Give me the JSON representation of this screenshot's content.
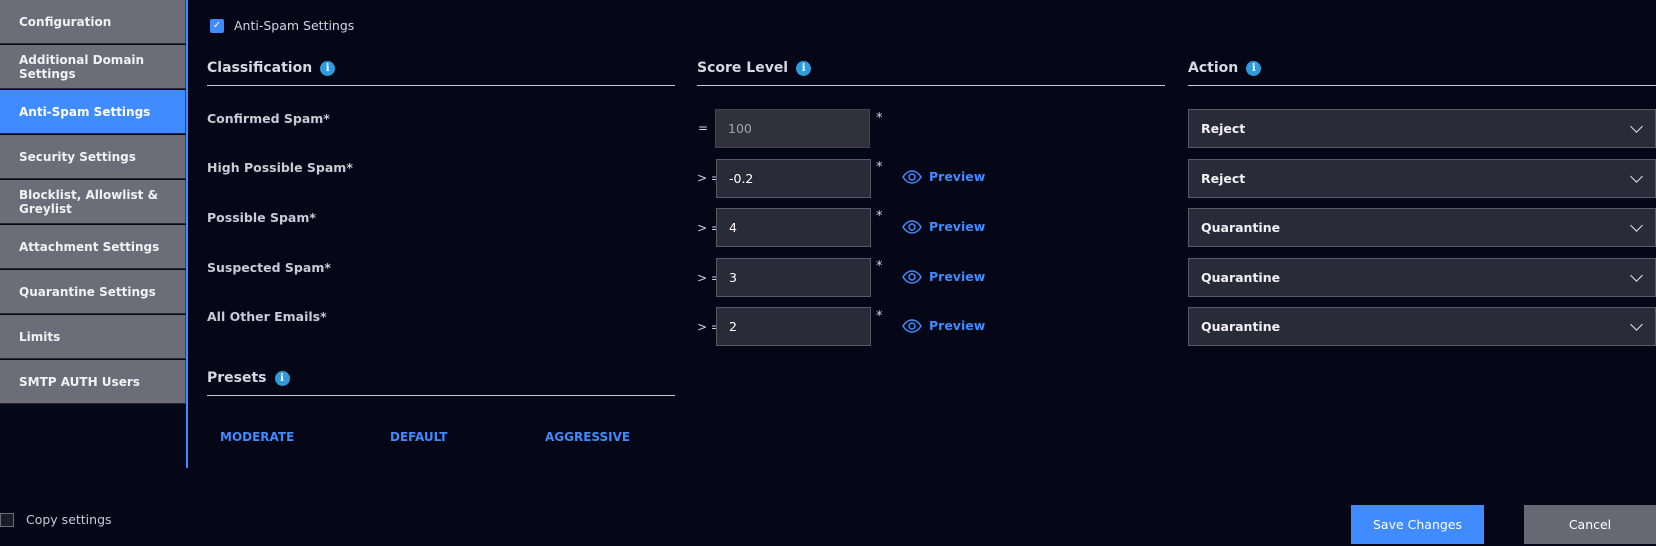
{
  "sidebar": {
    "items": [
      {
        "label": "Configuration"
      },
      {
        "label": "Additional Domain Settings"
      },
      {
        "label": "Anti-Spam Settings"
      },
      {
        "label": "Security Settings"
      },
      {
        "label": "Blocklist, Allowlist & Greylist"
      },
      {
        "label": "Attachment Settings"
      },
      {
        "label": "Quarantine Settings"
      },
      {
        "label": "Limits"
      },
      {
        "label": "SMTP AUTH Users"
      }
    ],
    "active_index": 2
  },
  "enable": {
    "label": "Anti-Spam Settings",
    "checked": true
  },
  "columns": {
    "classification": "Classification",
    "score_level": "Score Level",
    "action": "Action"
  },
  "rows": [
    {
      "label": "Confirmed Spam*",
      "operator": "=",
      "score": "100",
      "action": "Reject"
    },
    {
      "label": "High Possible Spam*",
      "operator": "> =",
      "score": "-0.2",
      "action": "Reject",
      "preview": "Preview"
    },
    {
      "label": "Possible Spam*",
      "operator": "> =",
      "score": "4",
      "action": "Quarantine",
      "preview": "Preview"
    },
    {
      "label": "Suspected Spam*",
      "operator": "> =",
      "score": "3",
      "action": "Quarantine",
      "preview": "Preview"
    },
    {
      "label": "All Other Emails*",
      "operator": "> =",
      "score": "2",
      "action": "Quarantine",
      "preview": "Preview"
    }
  ],
  "required_mark": "*",
  "presets": {
    "title": "Presets",
    "options": [
      "MODERATE",
      "DEFAULT",
      "AGGRESSIVE"
    ]
  },
  "footer": {
    "copy_label": "Copy settings",
    "save_label": "Save Changes",
    "cancel_label": "Cancel"
  },
  "colors": {
    "accent": "#3f8bff",
    "info": "#2e9bdc",
    "background": "#050616"
  }
}
